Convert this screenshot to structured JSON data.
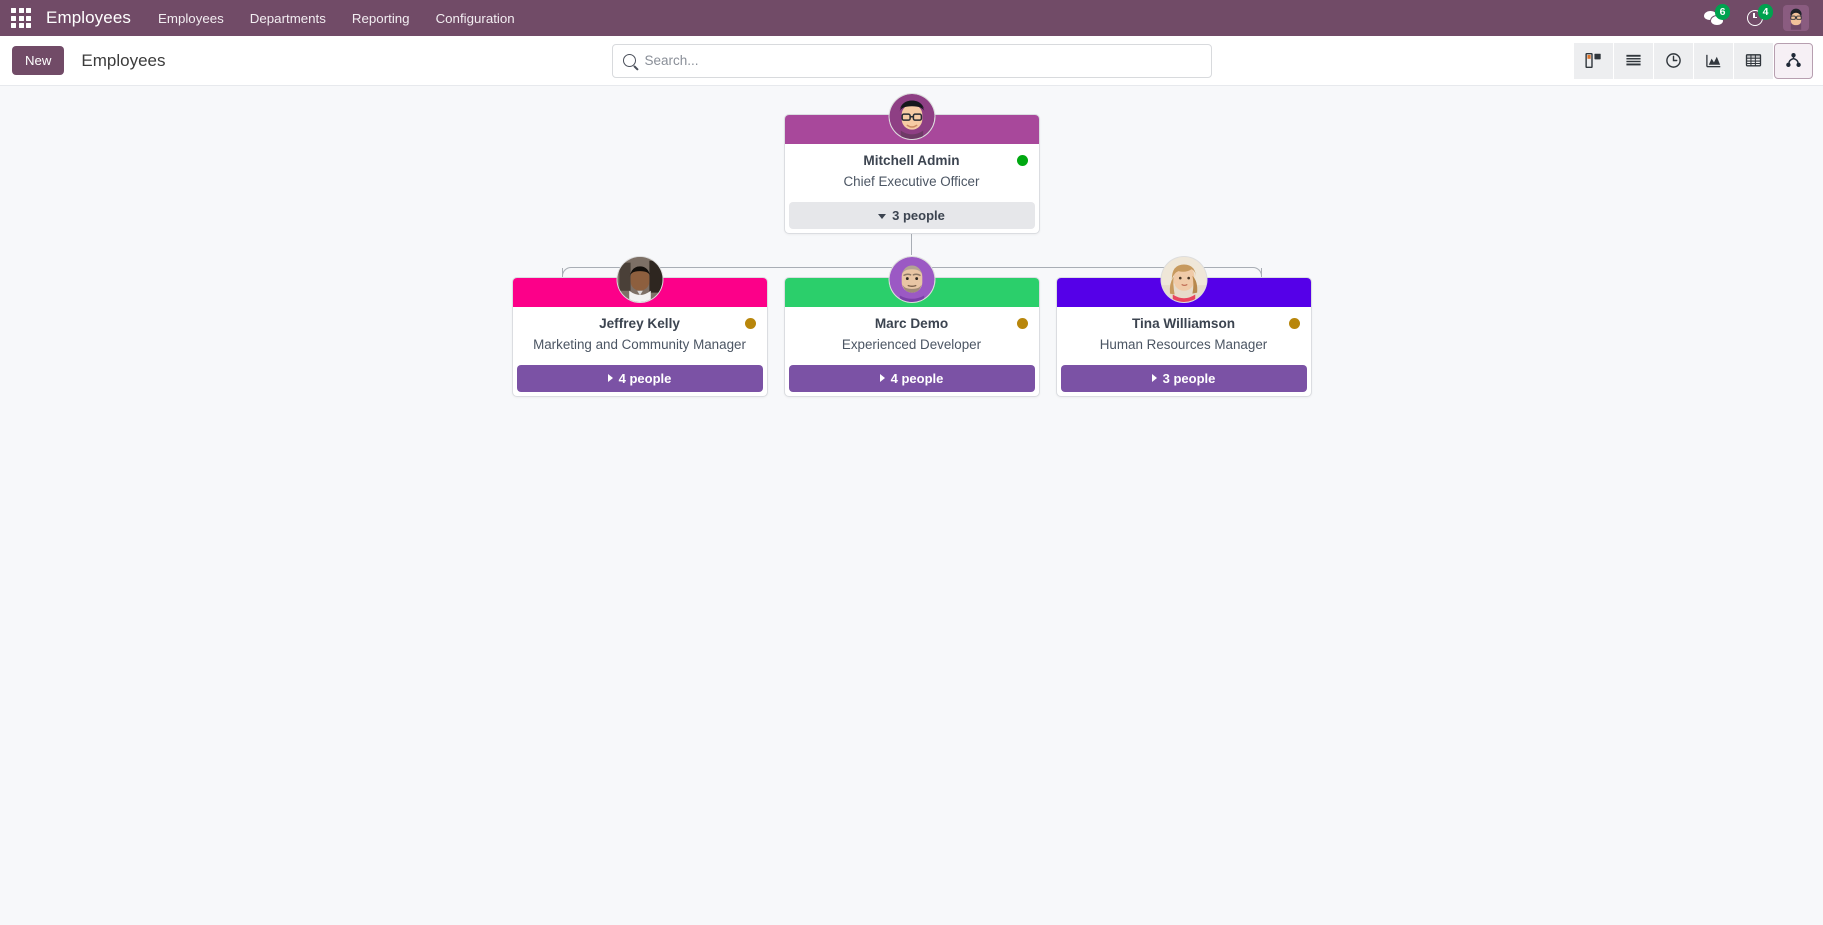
{
  "navbar": {
    "apps_icon": "apps-grid-icon",
    "brand": "Employees",
    "menu": [
      {
        "label": "Employees"
      },
      {
        "label": "Departments"
      },
      {
        "label": "Reporting"
      },
      {
        "label": "Configuration"
      }
    ],
    "messages": {
      "icon": "chat-icon",
      "count": "6"
    },
    "activities": {
      "icon": "clock-icon",
      "count": "4"
    },
    "user_avatar": "user-avatar"
  },
  "control_panel": {
    "new_label": "New",
    "title": "Employees",
    "search": {
      "icon": "search-icon",
      "value": "",
      "placeholder": "Search..."
    },
    "views": [
      {
        "name": "kanban",
        "icon": "kanban-icon",
        "active": false
      },
      {
        "name": "list",
        "icon": "list-icon",
        "active": false
      },
      {
        "name": "activity",
        "icon": "clock-icon",
        "active": false
      },
      {
        "name": "graph",
        "icon": "area-chart-icon",
        "active": false
      },
      {
        "name": "pivot",
        "icon": "table-icon",
        "active": false
      },
      {
        "name": "org_chart",
        "icon": "hierarchy-icon",
        "active": true
      }
    ]
  },
  "org_chart": {
    "root": {
      "name": "Mitchell Admin",
      "job_title": "Chief Executive Officer",
      "banner_color": "#A8489B",
      "status_color": "#00A811",
      "status_name": "green-status-dot",
      "subordinates_label": "3 people",
      "expanded": true
    },
    "children": [
      {
        "name": "Jeffrey Kelly",
        "job_title": "Marketing and Community Manager",
        "banner_color": "#FC0089",
        "status_color": "#B8860B",
        "status_name": "amber-status-dot",
        "subordinates_label": "4 people",
        "expanded": false
      },
      {
        "name": "Marc Demo",
        "job_title": "Experienced Developer",
        "banner_color": "#2BCF6B",
        "status_color": "#B8860B",
        "status_name": "amber-status-dot",
        "subordinates_label": "4 people",
        "expanded": false
      },
      {
        "name": "Tina Williamson",
        "job_title": "Human Resources Manager",
        "banner_color": "#5500E8",
        "status_color": "#B8860B",
        "status_name": "amber-status-dot",
        "subordinates_label": "3 people",
        "expanded": false
      }
    ]
  },
  "colors": {
    "brand_purple": "#714B67",
    "footer_collapsed": "#7B52A5",
    "footer_expanded": "#E6E7EA",
    "page_background": "#F7F8FA",
    "badge_green": "#00A24F"
  }
}
